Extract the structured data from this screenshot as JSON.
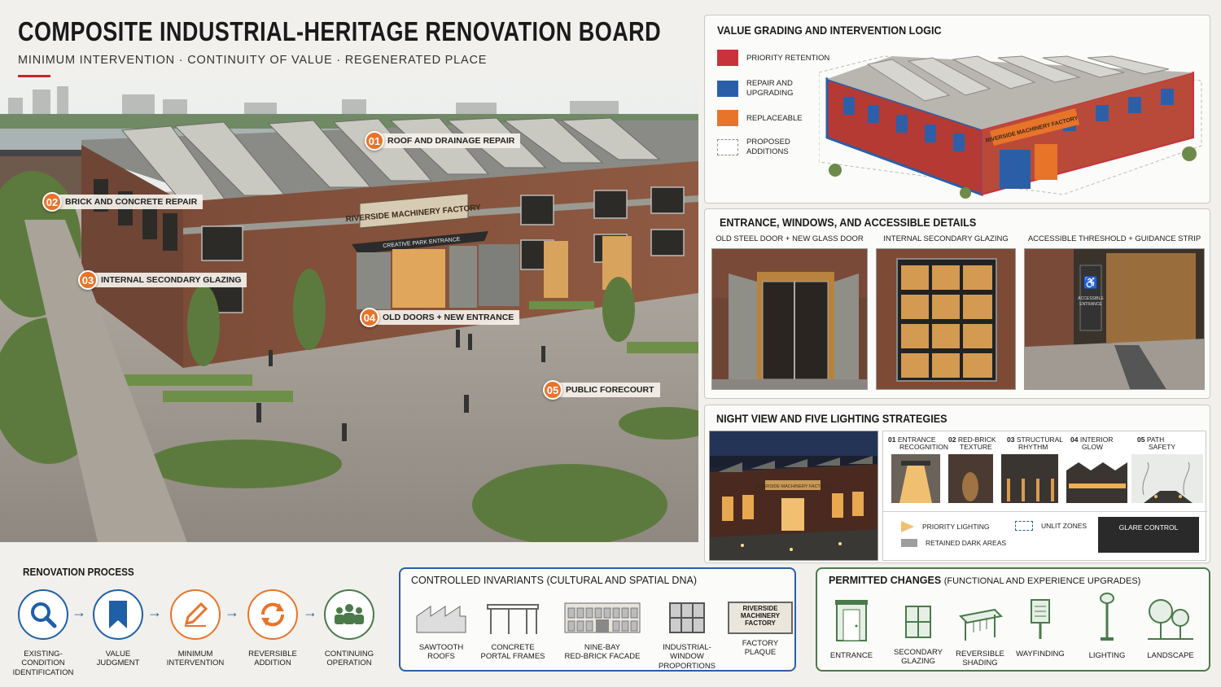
{
  "header": {
    "title": "COMPOSITE INDUSTRIAL-HERITAGE RENOVATION BOARD",
    "subtitle": "MINIMUM INTERVENTION · CONTINUITY OF VALUE · REGENERATED PLACE"
  },
  "hero": {
    "sign": "RIVERSIDE MACHINERY FACTORY",
    "entrance_sign": "CREATIVE PARK ENTRANCE",
    "callouts": [
      {
        "num": "01",
        "label": "ROOF AND DRAINAGE REPAIR"
      },
      {
        "num": "02",
        "label": "BRICK AND CONCRETE REPAIR"
      },
      {
        "num": "03",
        "label": "INTERNAL SECONDARY GLAZING"
      },
      {
        "num": "04",
        "label": "OLD DOORS + NEW ENTRANCE"
      },
      {
        "num": "05",
        "label": "PUBLIC FORECOURT"
      }
    ]
  },
  "value_panel": {
    "title": "VALUE GRADING AND INTERVENTION LOGIC",
    "legend": [
      {
        "label_1": "PRIORITY RETENTION",
        "label_2": "",
        "color": "#c8323a"
      },
      {
        "label_1": "REPAIR AND",
        "label_2": "UPGRADING",
        "color": "#2a5fa8"
      },
      {
        "label_1": "REPLACEABLE",
        "label_2": "",
        "color": "#e8742a"
      },
      {
        "label_1": "PROPOSED",
        "label_2": "ADDITIONS",
        "color": "#ffffff"
      }
    ],
    "sign": "RIVERSIDE MACHINERY FACTORY"
  },
  "entrance_panel": {
    "title": "ENTRANCE, WINDOWS, AND ACCESSIBLE DETAILS",
    "captions": [
      "OLD STEEL DOOR + NEW GLASS DOOR",
      "INTERNAL SECONDARY GLAZING",
      "ACCESSIBLE THRESHOLD + GUIDANCE STRIP"
    ],
    "access_sign_1": "ACCESSIBLE",
    "access_sign_2": "ENTRANCE"
  },
  "night_panel": {
    "title": "NIGHT VIEW AND FIVE LIGHTING STRATEGIES",
    "night_sign": "RIVERSIDE MACHINERY FACTORY",
    "strategies": [
      {
        "num": "01",
        "l1": "ENTRANCE",
        "l2": "RECOGNITION"
      },
      {
        "num": "02",
        "l1": "RED-BRICK",
        "l2": "TEXTURE"
      },
      {
        "num": "03",
        "l1": "STRUCTURAL",
        "l2": "RHYTHM"
      },
      {
        "num": "04",
        "l1": "INTERIOR",
        "l2": "GLOW"
      },
      {
        "num": "05",
        "l1": "PATH",
        "l2": "SAFETY"
      }
    ],
    "legend": {
      "priority": "PRIORITY LIGHTING",
      "unlit": "UNLIT ZONES",
      "dark": "RETAINED DARK AREAS",
      "glare": "GLARE CONTROL"
    }
  },
  "process": {
    "title": "RENOVATION PROCESS",
    "steps": [
      {
        "l1": "EXISTING-",
        "l2": "CONDITION",
        "l3": "IDENTIFICATION",
        "color": "#1f5fa8",
        "icon": "magnifier-icon"
      },
      {
        "l1": "VALUE",
        "l2": "JUDGMENT",
        "l3": "",
        "color": "#1f5fa8",
        "icon": "bookmark-icon"
      },
      {
        "l1": "MINIMUM",
        "l2": "INTERVENTION",
        "l3": "",
        "color": "#e8742a",
        "icon": "pencil-icon"
      },
      {
        "l1": "REVERSIBLE",
        "l2": "ADDITION",
        "l3": "",
        "color": "#e8742a",
        "icon": "cycle-icon"
      },
      {
        "l1": "CONTINUING",
        "l2": "OPERATION",
        "l3": "",
        "color": "#4a7a4a",
        "icon": "people-icon"
      }
    ]
  },
  "invariants": {
    "title": "CONTROLLED INVARIANTS (CULTURAL AND SPATIAL DNA)",
    "items": [
      {
        "l1": "SAWTOOTH",
        "l2": "ROOFS"
      },
      {
        "l1": "CONCRETE",
        "l2": "PORTAL FRAMES"
      },
      {
        "l1": "NINE-BAY",
        "l2": "RED-BRICK FACADE"
      },
      {
        "l1": "INDUSTRIAL-WINDOW",
        "l2": "PROPORTIONS"
      },
      {
        "l1": "FACTORY",
        "l2": "PLAQUE"
      }
    ],
    "plaque_1": "RIVERSIDE",
    "plaque_2": "MACHINERY",
    "plaque_3": "FACTORY"
  },
  "changes": {
    "title": "PERMITTED CHANGES",
    "title_suffix": "(FUNCTIONAL AND EXPERIENCE UPGRADES)",
    "items": [
      {
        "l1": "ENTRANCE",
        "l2": ""
      },
      {
        "l1": "SECONDARY",
        "l2": "GLAZING"
      },
      {
        "l1": "REVERSIBLE",
        "l2": "SHADING"
      },
      {
        "l1": "WAYFINDING",
        "l2": ""
      },
      {
        "l1": "LIGHTING",
        "l2": ""
      },
      {
        "l1": "LANDSCAPE",
        "l2": ""
      }
    ]
  }
}
